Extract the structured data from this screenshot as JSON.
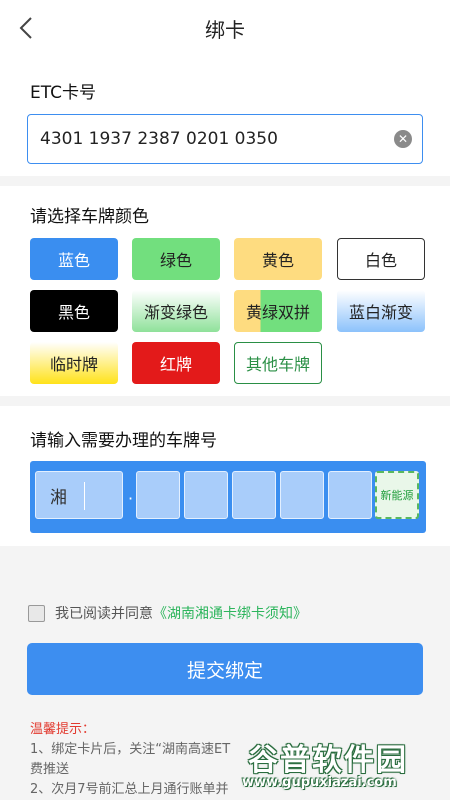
{
  "header": {
    "title": "绑卡"
  },
  "card": {
    "label": "ETC卡号",
    "value": "4301 1937 2387 0201 0350"
  },
  "plate_color": {
    "label": "请选择车牌颜色",
    "options": [
      "蓝色",
      "绿色",
      "黄色",
      "白色",
      "黑色",
      "渐变绿色",
      "黄绿双拼",
      "蓝白渐变",
      "临时牌",
      "红牌",
      "其他车牌"
    ]
  },
  "plate_number": {
    "label": "请输入需要办理的车牌号",
    "province": "湘",
    "separator": "·",
    "new_energy": "新能源"
  },
  "agreement": {
    "prefix": "我已阅读并同意",
    "link": "《湖南湘通卡绑卡须知》"
  },
  "submit": {
    "label": "提交绑定"
  },
  "tips": {
    "title": "温馨提示：",
    "lines": [
      "1、绑定卡片后，关注“湖南高速ET",
      "费推送",
      "2、次月7号前汇总上月通行账单并"
    ]
  },
  "watermark": {
    "main": "谷普软件园",
    "sub": "www.gupuxiazai.com"
  },
  "colors": {
    "accent": "#3d8ef0",
    "link": "#2db55d",
    "tip_red": "#e23a2f"
  }
}
